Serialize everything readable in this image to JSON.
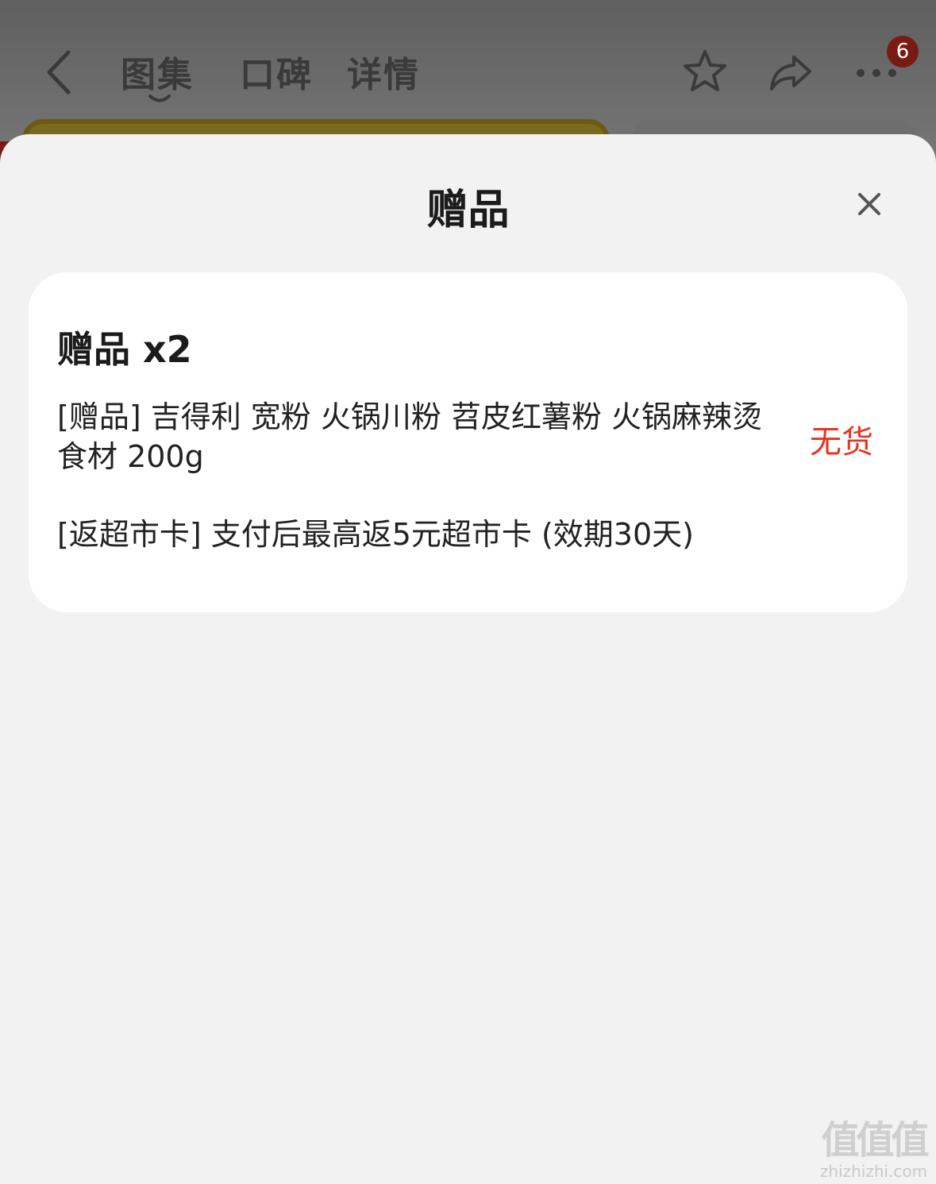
{
  "header": {
    "tabs": [
      {
        "label": "图集",
        "active": true
      },
      {
        "label": "口碑",
        "active": false
      },
      {
        "label": "详情",
        "active": false
      }
    ],
    "icons": [
      "back-icon",
      "star-icon",
      "share-icon",
      "more-icon"
    ],
    "badge_count": "6"
  },
  "sheet": {
    "title": "赠品",
    "close_icon": "close-icon",
    "card": {
      "heading": "赠品 x2",
      "gift_item": {
        "text": "[赠品] 吉得利 宽粉 火锅川粉 苕皮红薯粉 火锅麻辣烫食材 200g",
        "status": "无货"
      },
      "card_item": {
        "text": "[返超市卡] 支付后最高返5元超市卡 (效期30天)"
      }
    }
  },
  "watermark": {
    "mark": "值值值",
    "url": "zhizhizhi.com"
  },
  "colors": {
    "status_red": "#e8331f",
    "badge_bg": "#7a1a12",
    "sheet_bg": "#f2f2f2",
    "card_bg": "#ffffff"
  }
}
